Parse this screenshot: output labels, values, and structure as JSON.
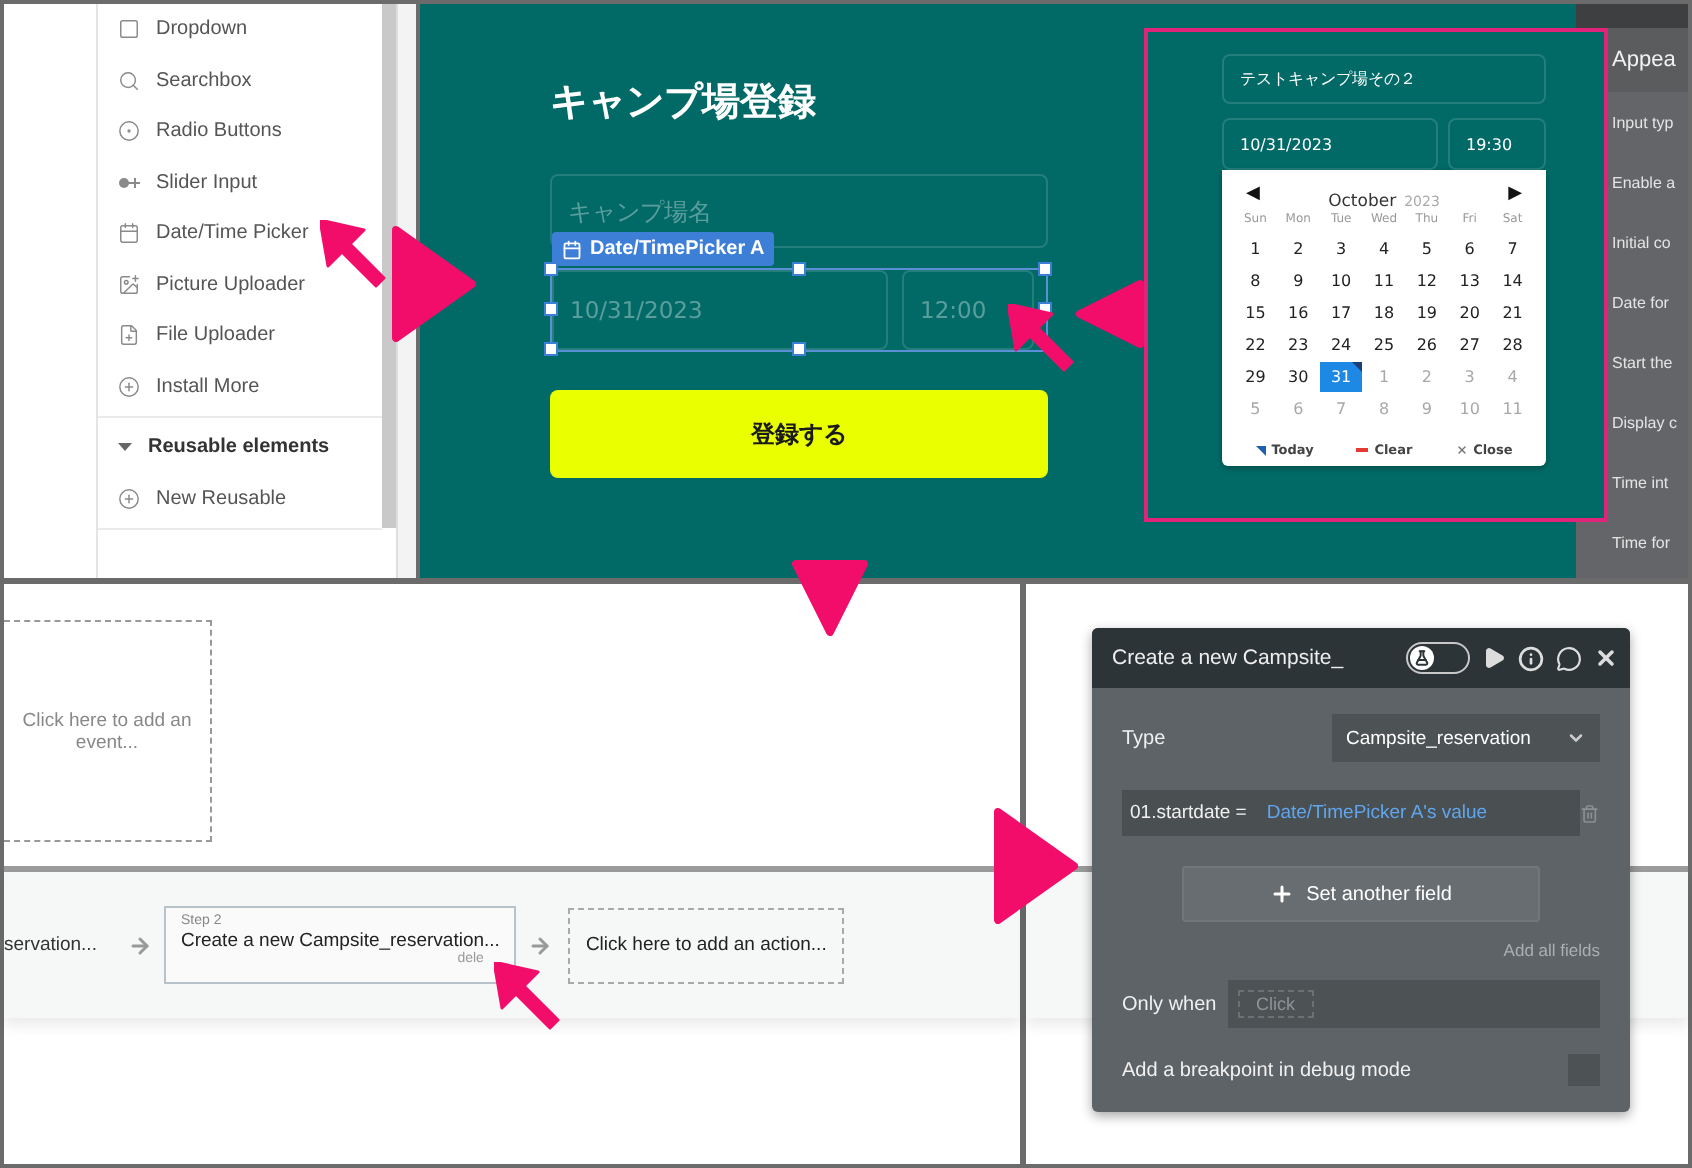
{
  "sidebar": {
    "items": [
      {
        "label": "Dropdown"
      },
      {
        "label": "Searchbox"
      },
      {
        "label": "Radio Buttons"
      },
      {
        "label": "Slider Input"
      },
      {
        "label": "Date/Time Picker"
      },
      {
        "label": "Picture Uploader"
      },
      {
        "label": "File Uploader"
      },
      {
        "label": "Install More"
      }
    ],
    "section": {
      "label": "Reusable elements",
      "expanded": true
    },
    "reusable_items": [
      {
        "label": "New Reusable"
      }
    ]
  },
  "canvas": {
    "title": "キャンプ場登録",
    "name_field": {
      "placeholder": "キャンプ場名"
    },
    "picker_tag": "Date/TimePicker A",
    "date_placeholder": "10/31/2023",
    "time_placeholder": "12:00",
    "submit_button": "登録する"
  },
  "preview": {
    "name_value": "テストキャンプ場その２",
    "date_value": "10/31/2023",
    "time_value": "19:30",
    "calendar": {
      "prev": "◀",
      "month": "October",
      "year": "2023",
      "next": "▶",
      "weekdays": [
        "Sun",
        "Mon",
        "Tue",
        "Wed",
        "Thu",
        "Fri",
        "Sat"
      ],
      "weeks": [
        [
          {
            "day": "1",
            "other_month": false,
            "selected": false,
            "today": false
          },
          {
            "day": "2",
            "other_month": false,
            "selected": false,
            "today": false
          },
          {
            "day": "3",
            "other_month": false,
            "selected": false,
            "today": false
          },
          {
            "day": "4",
            "other_month": false,
            "selected": false,
            "today": false
          },
          {
            "day": "5",
            "other_month": false,
            "selected": false,
            "today": false
          },
          {
            "day": "6",
            "other_month": false,
            "selected": false,
            "today": false
          },
          {
            "day": "7",
            "other_month": false,
            "selected": false,
            "today": false
          }
        ],
        [
          {
            "day": "8",
            "other_month": false,
            "selected": false,
            "today": false
          },
          {
            "day": "9",
            "other_month": false,
            "selected": false,
            "today": false
          },
          {
            "day": "10",
            "other_month": false,
            "selected": false,
            "today": false
          },
          {
            "day": "11",
            "other_month": false,
            "selected": false,
            "today": false
          },
          {
            "day": "12",
            "other_month": false,
            "selected": false,
            "today": false
          },
          {
            "day": "13",
            "other_month": false,
            "selected": false,
            "today": false
          },
          {
            "day": "14",
            "other_month": false,
            "selected": false,
            "today": false
          }
        ],
        [
          {
            "day": "15",
            "other_month": false,
            "selected": false,
            "today": false
          },
          {
            "day": "16",
            "other_month": false,
            "selected": false,
            "today": false
          },
          {
            "day": "17",
            "other_month": false,
            "selected": false,
            "today": false
          },
          {
            "day": "18",
            "other_month": false,
            "selected": false,
            "today": false
          },
          {
            "day": "19",
            "other_month": false,
            "selected": false,
            "today": false
          },
          {
            "day": "20",
            "other_month": false,
            "selected": false,
            "today": false
          },
          {
            "day": "21",
            "other_month": false,
            "selected": false,
            "today": false
          }
        ],
        [
          {
            "day": "22",
            "other_month": false,
            "selected": false,
            "today": false
          },
          {
            "day": "23",
            "other_month": false,
            "selected": false,
            "today": false
          },
          {
            "day": "24",
            "other_month": false,
            "selected": false,
            "today": false
          },
          {
            "day": "25",
            "other_month": false,
            "selected": false,
            "today": false
          },
          {
            "day": "26",
            "other_month": false,
            "selected": false,
            "today": false
          },
          {
            "day": "27",
            "other_month": false,
            "selected": false,
            "today": false
          },
          {
            "day": "28",
            "other_month": false,
            "selected": false,
            "today": false
          }
        ],
        [
          {
            "day": "29",
            "other_month": false,
            "selected": false,
            "today": false
          },
          {
            "day": "30",
            "other_month": false,
            "selected": false,
            "today": false
          },
          {
            "day": "31",
            "other_month": false,
            "selected": true,
            "today": true
          },
          {
            "day": "1",
            "other_month": true,
            "selected": false,
            "today": false
          },
          {
            "day": "2",
            "other_month": true,
            "selected": false,
            "today": false
          },
          {
            "day": "3",
            "other_month": true,
            "selected": false,
            "today": false
          },
          {
            "day": "4",
            "other_month": true,
            "selected": false,
            "today": false
          }
        ],
        [
          {
            "day": "5",
            "other_month": true,
            "selected": false,
            "today": false
          },
          {
            "day": "6",
            "other_month": true,
            "selected": false,
            "today": false
          },
          {
            "day": "7",
            "other_month": true,
            "selected": false,
            "today": false
          },
          {
            "day": "8",
            "other_month": true,
            "selected": false,
            "today": false
          },
          {
            "day": "9",
            "other_month": true,
            "selected": false,
            "today": false
          },
          {
            "day": "10",
            "other_month": true,
            "selected": false,
            "today": false
          },
          {
            "day": "11",
            "other_month": true,
            "selected": false,
            "today": false
          }
        ]
      ],
      "footer": [
        {
          "kind": "today",
          "label": "Today"
        },
        {
          "kind": "clear",
          "label": "Clear"
        },
        {
          "kind": "close",
          "label": "Close"
        }
      ]
    }
  },
  "properties": {
    "heading": "Appea",
    "labels": [
      "Input typ",
      "Enable a",
      "Initial co",
      "Date for",
      "Start the",
      "Display c",
      "Time int",
      "Time for"
    ]
  },
  "workflow": {
    "event_box": "Click here to add an event...",
    "previous_step_text": "servation...",
    "step": {
      "number": "Step 2",
      "text": "Create a new Campsite_reservation...",
      "delete": "dele"
    },
    "add_action": "Click here to add an action..."
  },
  "action_panel": {
    "title": "Create a new Campsite_",
    "debug_toggle_on": false,
    "type_label": "Type",
    "type_value": "Campsite_reservation",
    "fields": [
      {
        "name": "01.startdate =",
        "value": "Date/TimePicker A's value"
      }
    ],
    "set_field_button": "Set another field",
    "add_all_link": "Add all fields",
    "only_when_label": "Only when",
    "only_when_chip": "Click",
    "breakpoint_label": "Add a breakpoint in debug mode",
    "breakpoint_checked": false
  }
}
